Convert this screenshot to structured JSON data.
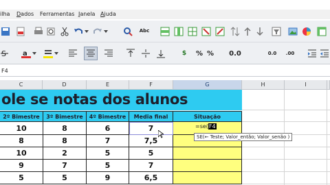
{
  "menu": [
    "ilha",
    "Dados",
    "Ferramentas",
    "Janela",
    "Ajuda"
  ],
  "menu_mnemonic": [
    "",
    "D",
    "",
    "J",
    "A"
  ],
  "cell_ref": "F4",
  "columns": [
    "C",
    "D",
    "E",
    "F",
    "G",
    "H",
    "I"
  ],
  "selected_column": "G",
  "title": "ole se notas dos alunos",
  "headers": [
    "2º Bimestre",
    "3º Bimestre",
    "4º Bimestre",
    "Media final",
    "Situação"
  ],
  "rows": [
    [
      "10",
      "8",
      "6",
      "7"
    ],
    [
      "8",
      "8",
      "7",
      "7,5"
    ],
    [
      "10",
      "2",
      "5",
      "5"
    ],
    [
      "9",
      "7",
      "5",
      "7"
    ],
    [
      "5",
      "5",
      "9",
      "6,5"
    ]
  ],
  "formula": {
    "prefix": "=se(",
    "selected": "F4"
  },
  "tooltip": "SE(← Teste; Valor_então; Valor_senão )",
  "toolbar": {
    "abc_label": "Abc",
    "decimal_add": "0.0",
    "decimal_remove": ".00",
    "zoom_label": "0.0"
  },
  "colors": {
    "title_bg": "#2ecbf1",
    "situacao_bg": "#ffff7f",
    "selected_col_bg": "#c8d6ea"
  }
}
